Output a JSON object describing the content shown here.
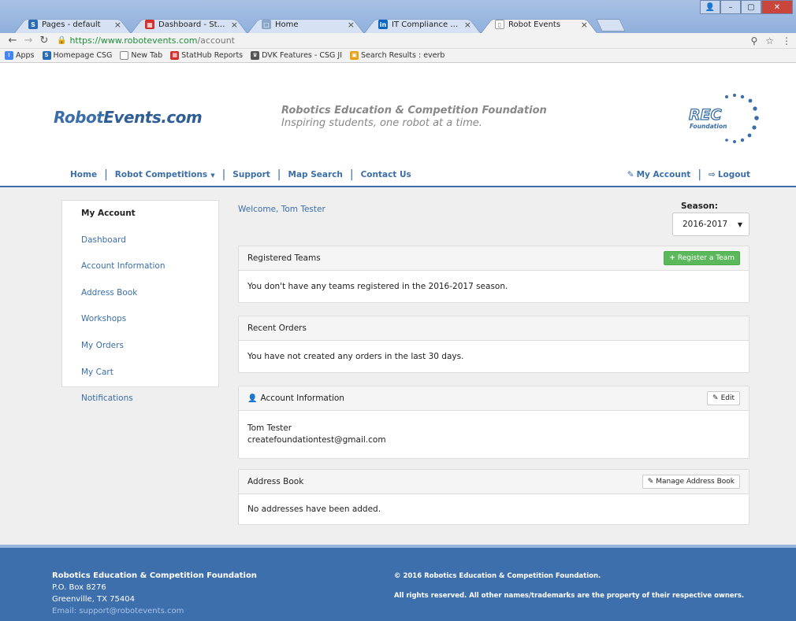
{
  "browser": {
    "tabs": [
      {
        "title": "Pages - default",
        "favicon": "S",
        "favicon_color": "#2a6bb6",
        "active": false
      },
      {
        "title": "Dashboard - StatHub Re",
        "favicon": "▦",
        "favicon_color": "#d0312d",
        "active": false
      },
      {
        "title": "Home",
        "favicon": "▢",
        "favicon_color": "#8aa7c9",
        "active": false
      },
      {
        "title": "IT Compliance Manager",
        "favicon": "in",
        "favicon_color": "#0a66c2",
        "active": false
      },
      {
        "title": "Robot Events",
        "favicon": "▯",
        "favicon_color": "#777777",
        "active": true
      }
    ],
    "url_host": "https://www.robotevents.com",
    "url_path": "/account",
    "bookmarks": [
      {
        "label": "Apps",
        "color": "#4285f4"
      },
      {
        "label": "Homepage CSG",
        "color": "#2a6bb6"
      },
      {
        "label": "New Tab",
        "color": "#888888"
      },
      {
        "label": "StatHub Reports",
        "color": "#d0312d"
      },
      {
        "label": "DVK Features - CSG JI",
        "color": "#555555"
      },
      {
        "label": "Search Results : everb",
        "color": "#e6a117"
      }
    ]
  },
  "header": {
    "logo_a": "Robot",
    "logo_b": "Events.com",
    "tagline_1": "Robotics Education & Competition Foundation",
    "tagline_2": "Inspiring students, one robot at a time.",
    "rec_letters": "REC",
    "rec_sub": "Foundation"
  },
  "nav": {
    "left": [
      "Home",
      "Robot Competitions",
      "Support",
      "Map Search",
      "Contact Us"
    ],
    "my_account": "My Account",
    "logout": "Logout"
  },
  "sidebar": {
    "items": [
      "My Account",
      "Dashboard",
      "Account Information",
      "Address Book",
      "Workshops",
      "My Orders",
      "My Cart",
      "Notifications"
    ]
  },
  "main": {
    "welcome": "Welcome, Tom Tester",
    "season_label": "Season:",
    "season_value": "2016-2017",
    "teams": {
      "title": "Registered Teams",
      "button": "Register a Team",
      "body": "You don't have any teams registered in the 2016-2017 season."
    },
    "orders": {
      "title": "Recent Orders",
      "body": "You have not created any orders in the last 30 days."
    },
    "account": {
      "title": "Account Information",
      "button": "Edit",
      "name": "Tom Tester",
      "email": "createfoundationtest@gmail.com"
    },
    "address": {
      "title": "Address Book",
      "button": "Manage Address Book",
      "body": "No addresses have been added."
    }
  },
  "footer": {
    "org": "Robotics Education & Competition Foundation",
    "po": "P.O. Box 8276",
    "city": "Greenville, TX 75404",
    "email": "Email: support@robotevents.com",
    "copyright": "© 2016 Robotics Education & Competition Foundation.",
    "rights": "All rights reserved. All other names/trademarks are the property of their respective owners."
  }
}
